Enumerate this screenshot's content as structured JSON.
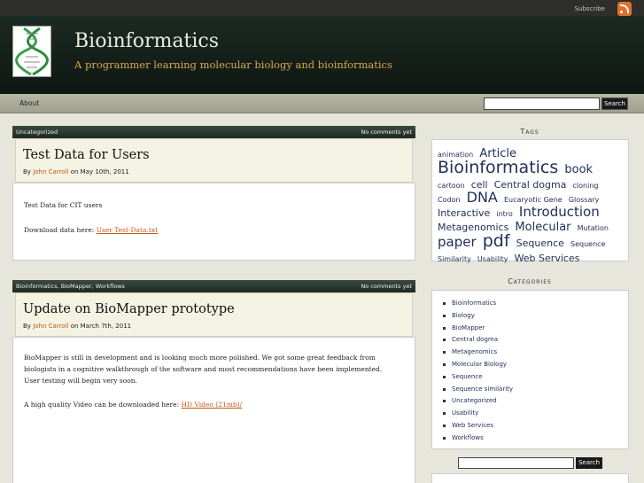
{
  "topbar": {
    "subscribe_label": "Subscribe",
    "feed_icon": "rss-icon"
  },
  "header": {
    "title": "Bioinformatics",
    "tagline": "A programmer learning molecular biology and bioinformatics",
    "logo_icon": "dna-logo-icon"
  },
  "nav": {
    "items": [
      {
        "label": "About"
      }
    ],
    "search_button": "Search",
    "search_value": ""
  },
  "posts": [
    {
      "categories": "Uncategorized",
      "comments": "No comments yet",
      "title": "Test Data for Users",
      "by": "By",
      "author": "John Carroll",
      "date": "on May 10th, 2011",
      "body": [
        "Test Data for CIT users"
      ],
      "link_prefix": "Download data here: ",
      "link_text": "User Test-Data.txt"
    },
    {
      "categories": "Bioinformatics, BioMapper, Workflows",
      "comments": "No comments yet",
      "title": "Update on BioMapper prototype",
      "by": "By",
      "author": "John Carroll",
      "date": "on March 7th, 2011",
      "body": [
        "BioMapper is still in development and is looking much more polished. We got some great feedback from biologists in a cognitive walkthrough of the software and most recommendations have been implemented.",
        "User testing will begin very soon."
      ],
      "link_prefix": "A high quality Video can be downloaded here: ",
      "link_text": "HD Video (21mb)/"
    }
  ],
  "sidebar": {
    "tags_title": "Tags",
    "tags": [
      {
        "text": "animation",
        "size": 8
      },
      {
        "text": "Article",
        "size": 13
      },
      {
        "text": "Bioinformatics",
        "size": 19
      },
      {
        "text": "book",
        "size": 13
      },
      {
        "text": "cartoon",
        "size": 8
      },
      {
        "text": "cell",
        "size": 11
      },
      {
        "text": "Central dogma",
        "size": 11
      },
      {
        "text": "cloning",
        "size": 8
      },
      {
        "text": "Codon",
        "size": 8
      },
      {
        "text": "DNA",
        "size": 16
      },
      {
        "text": "Eucaryotic Gene",
        "size": 8
      },
      {
        "text": "Glossary",
        "size": 8
      },
      {
        "text": "Interactive",
        "size": 11
      },
      {
        "text": "intro",
        "size": 8
      },
      {
        "text": "Introduction",
        "size": 15
      },
      {
        "text": "Metagenomics",
        "size": 11
      },
      {
        "text": "Molecular",
        "size": 13
      },
      {
        "text": "Mutation",
        "size": 8
      },
      {
        "text": "paper",
        "size": 15
      },
      {
        "text": "pdf",
        "size": 19
      },
      {
        "text": "Sequence",
        "size": 11
      },
      {
        "text": "Sequence Similarity",
        "size": 8
      },
      {
        "text": "Usability",
        "size": 8
      },
      {
        "text": "Web Services",
        "size": 11
      }
    ],
    "categories_title": "Categories",
    "categories": [
      "Bioinformatics",
      "Biology",
      "BioMapper",
      "Central dogma",
      "Metagenomics",
      "Molecular Biology",
      "Sequence",
      "Sequence similarity",
      "Uncategorized",
      "Usability",
      "Web Services",
      "Workflows"
    ],
    "search_button": "Search",
    "search_value": ""
  },
  "colors": {
    "header_bg": "#1c2a24",
    "tagline": "#d8a84a",
    "link": "#c05a1a",
    "tag_link": "#22305a",
    "rss": "#e0702a"
  }
}
